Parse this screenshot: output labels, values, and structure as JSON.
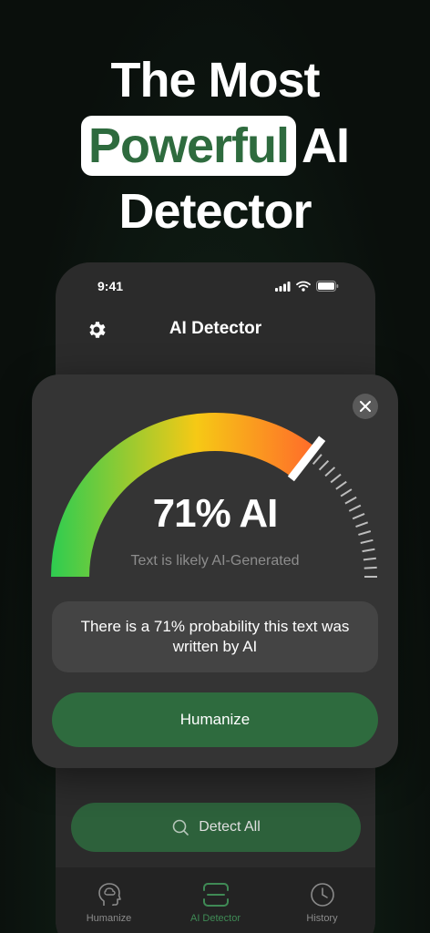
{
  "headline": {
    "line1": "The Most",
    "highlight": "Powerful",
    "line2_rest": "AI",
    "line3": "Detector"
  },
  "phone": {
    "status_time": "9:41",
    "app_title": "AI Detector",
    "detect_all_label": "Detect All",
    "tabs": [
      {
        "label": "Humanize",
        "icon": "brain-head-icon",
        "active": false
      },
      {
        "label": "AI Detector",
        "icon": "scan-frame-icon",
        "active": true
      },
      {
        "label": "History",
        "icon": "clock-icon",
        "active": false
      }
    ]
  },
  "result": {
    "percent_label": "71% AI",
    "ai_probability": 0.71,
    "subtitle": "Text is likely AI-Generated",
    "description": "There is a 71% probability this text was written by AI",
    "humanize_label": "Humanize"
  },
  "colors": {
    "brand_green": "#2e6b3e",
    "gauge_start": "#2ecc50",
    "gauge_mid": "#f6c915",
    "gauge_end": "#ff6a2a"
  }
}
